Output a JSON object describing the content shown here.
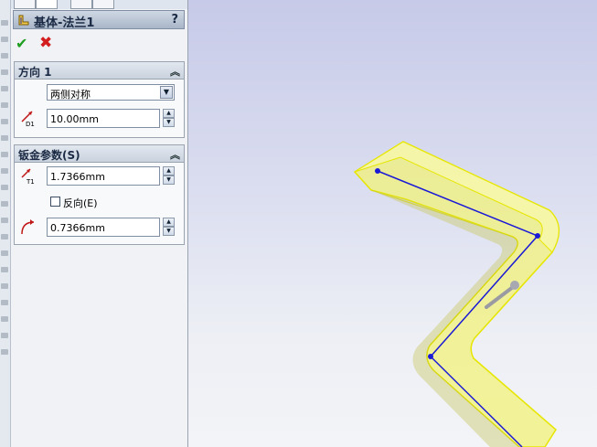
{
  "panel": {
    "title": "基体-法兰1",
    "help": "?",
    "ok_symbol": "✔",
    "cancel_symbol": "✖"
  },
  "direction1": {
    "header": "方向 1",
    "end_condition": "两侧对称",
    "depth": "10.00mm"
  },
  "sheetmetal_params": {
    "header": "钣金参数(S)",
    "thickness": "1.7366mm",
    "reverse_label": "反向(E)",
    "reverse_checked": false,
    "bend_radius": "0.7366mm"
  },
  "icons": {
    "title": "base-flange-icon",
    "help": "help-icon",
    "collapse": "double-chevron-up-icon",
    "depth": "depth-d1-icon",
    "thickness": "thickness-t1-icon",
    "radius": "bend-radius-icon"
  },
  "colors": {
    "model_fill": "#f2f27a",
    "model_edge": "#e6e600",
    "sketch_line": "#1a1ad6",
    "ok": "#1e9d1e",
    "cancel": "#d21e1e"
  }
}
